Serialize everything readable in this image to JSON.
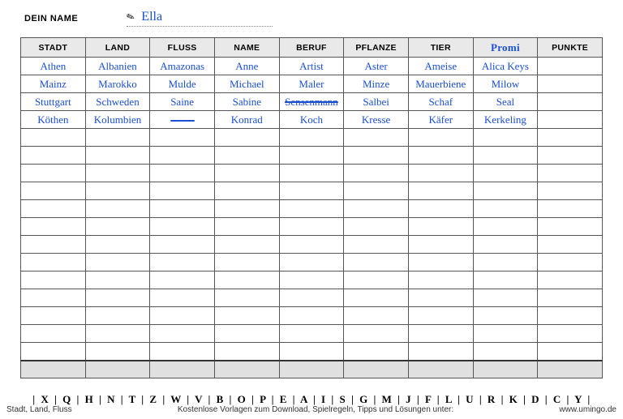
{
  "name_label": "DEIN NAME",
  "player_name": "Ella",
  "columns": [
    {
      "label": "STADT",
      "hand": false
    },
    {
      "label": "LAND",
      "hand": false
    },
    {
      "label": "FLUSS",
      "hand": false
    },
    {
      "label": "NAME",
      "hand": false
    },
    {
      "label": "BERUF",
      "hand": false
    },
    {
      "label": "PFLANZE",
      "hand": false
    },
    {
      "label": "TIER",
      "hand": false
    },
    {
      "label": "Promi",
      "hand": true
    },
    {
      "label": "PUNKTE",
      "hand": false
    }
  ],
  "rows": [
    [
      "Athen",
      "Albanien",
      "Amazonas",
      "Anne",
      "Artist",
      "Aster",
      "Ameise",
      "Alica Keys",
      ""
    ],
    [
      "Mainz",
      "Marokko",
      "Mulde",
      "Michael",
      "Maler",
      "Minze",
      "Mauerbiene",
      "Milow",
      ""
    ],
    [
      "Stuttgart",
      "Schweden",
      "Saine",
      "Sabine",
      {
        "text": "Sensenmann",
        "strike": true
      },
      "Salbei",
      "Schaf",
      "Seal",
      ""
    ],
    [
      "Köthen",
      "Kolumbien",
      {
        "dash": true
      },
      "Konrad",
      "Koch",
      "Kresse",
      "Käfer",
      "Kerkeling",
      ""
    ]
  ],
  "empty_rows": 13,
  "chart_data": {
    "type": "table",
    "title": "Stadt, Land, Fluss",
    "categories": [
      "STADT",
      "LAND",
      "FLUSS",
      "NAME",
      "BERUF",
      "PFLANZE",
      "TIER",
      "Promi",
      "PUNKTE"
    ],
    "values": [
      [
        "Athen",
        "Albanien",
        "Amazonas",
        "Anne",
        "Artist",
        "Aster",
        "Ameise",
        "Alica Keys",
        ""
      ],
      [
        "Mainz",
        "Marokko",
        "Mulde",
        "Michael",
        "Maler",
        "Minze",
        "Mauerbiene",
        "Milow",
        ""
      ],
      [
        "Stuttgart",
        "Schweden",
        "Saine",
        "Sabine",
        "Sensenmann (crossed out)",
        "Salbei",
        "Schaf",
        "Seal",
        ""
      ],
      [
        "Köthen",
        "Kolumbien",
        "— (dash)",
        "Konrad",
        "Koch",
        "Kresse",
        "Käfer",
        "Kerkeling",
        ""
      ]
    ]
  },
  "letters": [
    "X",
    "Q",
    "H",
    "N",
    "T",
    "Z",
    "W",
    "V",
    "B",
    "O",
    "P",
    "E",
    "A",
    "I",
    "S",
    "G",
    "M",
    "J",
    "F",
    "L",
    "U",
    "R",
    "K",
    "D",
    "C",
    "Y"
  ],
  "footer": {
    "left": "Stadt, Land, Fluss",
    "mid": "Kostenlose Vorlagen zum Download, Spielregeln, Tipps und Lösungen unter:",
    "right": "www.umingo.de"
  }
}
